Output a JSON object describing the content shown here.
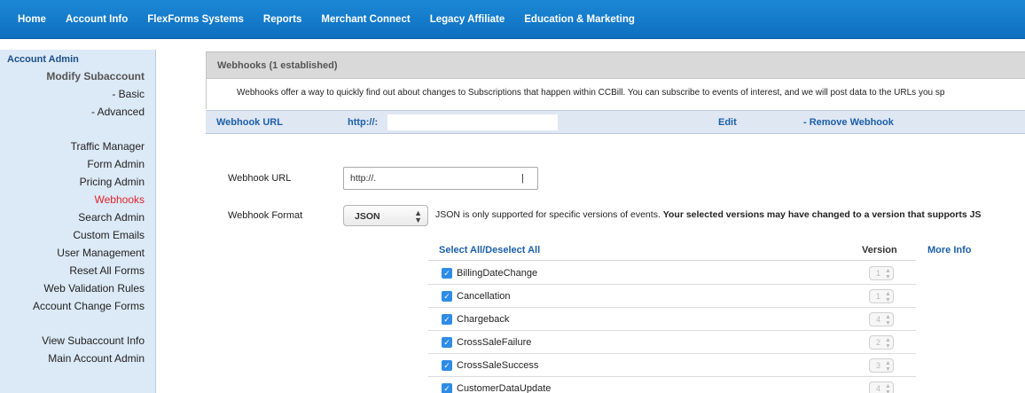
{
  "topnav": {
    "items": [
      "Home",
      "Account Info",
      "FlexForms Systems",
      "Reports",
      "Merchant Connect",
      "Legacy Affiliate",
      "Education & Marketing"
    ]
  },
  "sidebar": {
    "title": "Account Admin",
    "items": [
      {
        "label": "Modify Subaccount"
      },
      {
        "label": "- Basic"
      },
      {
        "label": "- Advanced"
      },
      {
        "label": "Traffic Manager"
      },
      {
        "label": "Form Admin"
      },
      {
        "label": "Pricing Admin"
      },
      {
        "label": "Webhooks"
      },
      {
        "label": "Search Admin"
      },
      {
        "label": "Custom Emails"
      },
      {
        "label": "User Management"
      },
      {
        "label": "Reset All Forms"
      },
      {
        "label": "Web Validation Rules"
      },
      {
        "label": "Account Change Forms"
      },
      {
        "label": "View Subaccount Info"
      },
      {
        "label": "Main Account Admin"
      }
    ]
  },
  "panel": {
    "header": "Webhooks (1 established)",
    "description": "Webhooks offer a way to quickly find out about changes to Subscriptions that happen within CCBill. You can subscribe to events of interest, and we will post data to the URLs you sp",
    "webhook_row": {
      "label": "Webhook URL",
      "url": "http://:",
      "edit": "Edit",
      "remove": "- Remove Webhook"
    }
  },
  "form": {
    "url_label": "Webhook URL",
    "url_value": "http://.",
    "format_label": "Webhook Format",
    "format_value": "JSON",
    "format_note_plain": "JSON is only supported for specific versions of events. ",
    "format_note_bold": "Your selected versions may have changed to a version that supports JS"
  },
  "events": {
    "select_all": "Select All/Deselect All",
    "version_header": "Version",
    "more_info": "More Info",
    "rows": [
      {
        "name": "BillingDateChange",
        "version": "1"
      },
      {
        "name": "Cancellation",
        "version": "1"
      },
      {
        "name": "Chargeback",
        "version": "4"
      },
      {
        "name": "CrossSaleFailure",
        "version": "2"
      },
      {
        "name": "CrossSaleSuccess",
        "version": "3"
      },
      {
        "name": "CustomerDataUpdate",
        "version": "4"
      }
    ]
  },
  "colors": {
    "nav_blue": "#1b88d6",
    "sidebar_bg": "#dce9f6",
    "link_blue": "#1b5fa8",
    "active_red": "#e3232a",
    "checkbox_blue": "#2e8ce6"
  }
}
